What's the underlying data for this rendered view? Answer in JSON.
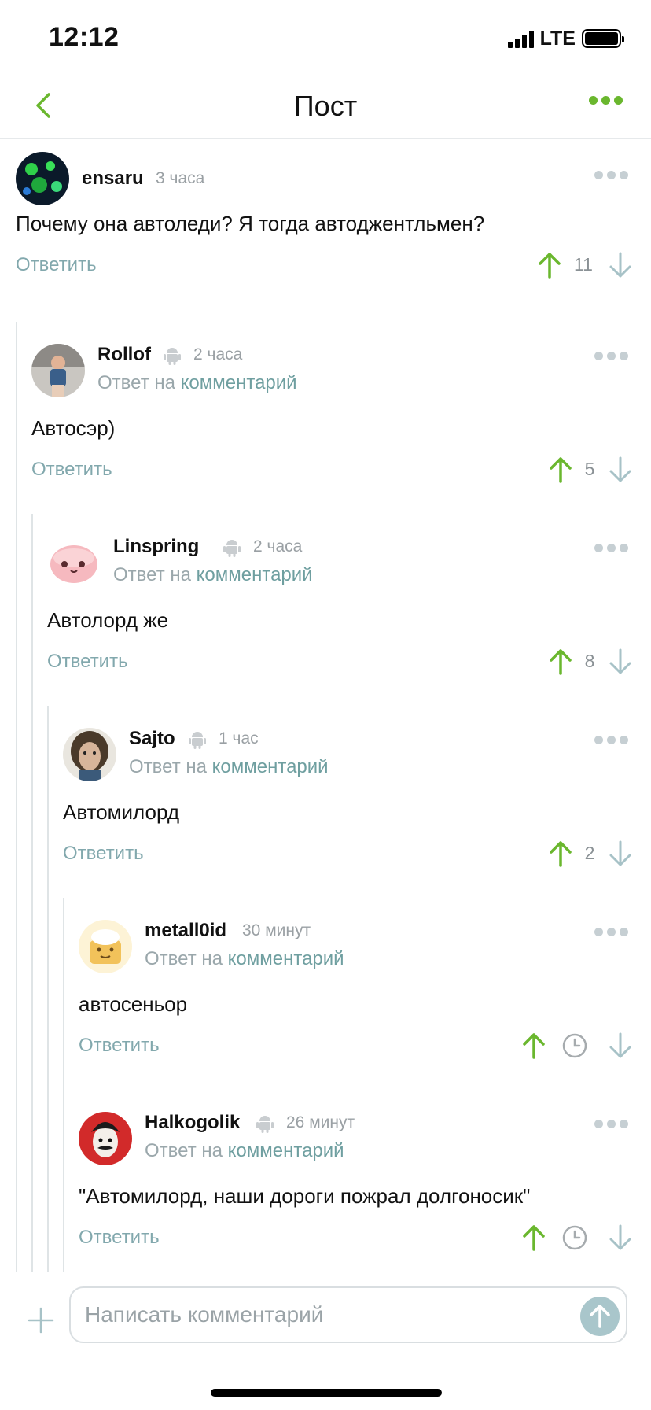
{
  "status_bar": {
    "time": "12:12",
    "network": "LTE"
  },
  "nav": {
    "title": "Пост"
  },
  "reply_prefix": "Ответ на",
  "reply_link": "комментарий",
  "reply_label": "Ответить",
  "comments": [
    {
      "author": "ensaru",
      "time": "3 часа",
      "text": "Почему она автоледи? Я тогда автоджентльмен?",
      "score": "11"
    },
    {
      "author": "Rollof",
      "time": "2 часа",
      "text": "Автосэр)",
      "score": "5"
    },
    {
      "author": "Linspring",
      "time": "2 часа",
      "text": "Автолорд же",
      "score": "8"
    },
    {
      "author": "Sajto",
      "time": "1 час",
      "text": "Автомилорд",
      "score": "2"
    },
    {
      "author": "metall0id",
      "time": "30 минут",
      "text": "автосеньор",
      "score": ""
    },
    {
      "author": "Halkogolik",
      "time": "26 минут",
      "text": "\"Автомилорд, наши дороги пожрал долгоносик\"",
      "score": ""
    }
  ],
  "composer": {
    "placeholder": "Написать комментарий"
  },
  "colors": {
    "accent": "#6ab72e",
    "link": "#6f9fa0",
    "muted": "#9aa0a4",
    "send_button": "#a9c6cb"
  },
  "icons": [
    "back-icon",
    "more-icon",
    "android-icon",
    "arrow-up-icon",
    "arrow-down-icon",
    "clock-icon",
    "plus-icon",
    "send-arrow-icon"
  ]
}
